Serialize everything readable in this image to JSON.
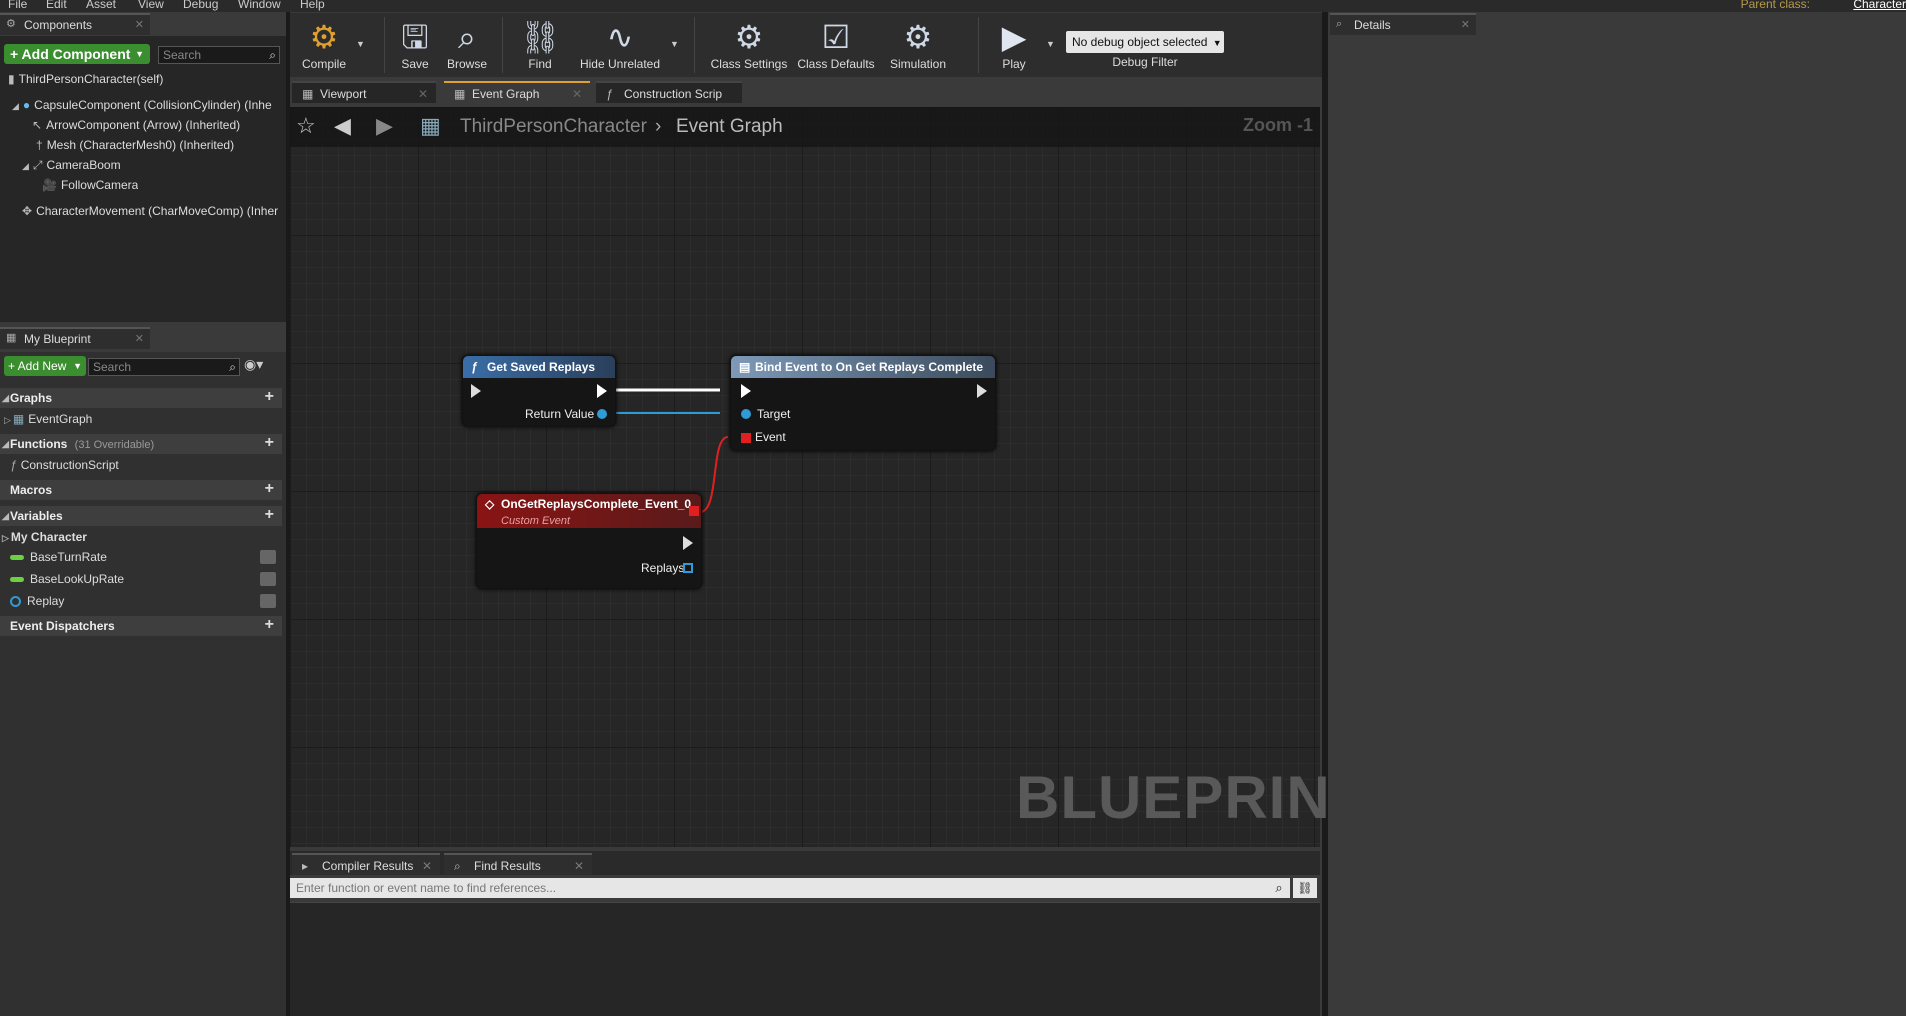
{
  "menu": [
    "File",
    "Edit",
    "Asset",
    "View",
    "Debug",
    "Window",
    "Help"
  ],
  "parent_class": {
    "label": "Parent class:",
    "value": "Character"
  },
  "components": {
    "tab": "Components",
    "add_label": "+ Add Component",
    "search_placeholder": "Search",
    "items": [
      "ThirdPersonCharacter(self)",
      "CapsuleComponent (CollisionCylinder) (Inhe",
      "ArrowComponent (Arrow) (Inherited)",
      "Mesh (CharacterMesh0) (Inherited)",
      "CameraBoom",
      "FollowCamera",
      "CharacterMovement (CharMoveComp) (Inher"
    ]
  },
  "my_blueprint": {
    "tab": "My Blueprint",
    "add_label": "+ Add New",
    "search_placeholder": "Search",
    "graphs": {
      "label": "Graphs",
      "items": [
        "EventGraph"
      ]
    },
    "functions": {
      "label": "Functions",
      "note": "(31 Overridable)",
      "items": [
        "ConstructionScript"
      ]
    },
    "macros": {
      "label": "Macros"
    },
    "variables": {
      "label": "Variables",
      "category": "My Character",
      "items": [
        "BaseTurnRate",
        "BaseLookUpRate",
        "Replay"
      ]
    },
    "dispatchers": {
      "label": "Event Dispatchers"
    }
  },
  "toolbar": {
    "compile": "Compile",
    "save": "Save",
    "browse": "Browse",
    "find": "Find",
    "hide_unrelated": "Hide Unrelated",
    "class_settings": "Class Settings",
    "class_defaults": "Class Defaults",
    "simulation": "Simulation",
    "play": "Play",
    "debug_object": "No debug object selected",
    "debug_filter": "Debug Filter"
  },
  "doc_tabs": [
    "Viewport",
    "Event Graph",
    "Construction Scrip"
  ],
  "breadcrumb": {
    "root": "ThirdPersonCharacter",
    "current": "Event Graph"
  },
  "zoom": "Zoom -1",
  "watermark": "BLUEPRINT",
  "nodes": {
    "get_saved_replays": {
      "title": "Get Saved Replays",
      "return_value": "Return Value"
    },
    "bind_event": {
      "title": "Bind Event to On Get Replays Complete",
      "target": "Target",
      "event": "Event"
    },
    "custom_event": {
      "title": "OnGetReplaysComplete_Event_0",
      "subtitle": "Custom Event",
      "replays": "Replays"
    }
  },
  "details": {
    "tab": "Details"
  },
  "bottom": {
    "tabs": [
      "Compiler Results",
      "Find Results"
    ],
    "find_placeholder": "Enter function or event name to find references..."
  },
  "colors": {
    "accent_green": "#3b8e2f",
    "exec_white": "#ffffff",
    "object_pin": "#2e9ad6",
    "event_red": "#e02020",
    "custom_event_header": "#8a1414"
  }
}
